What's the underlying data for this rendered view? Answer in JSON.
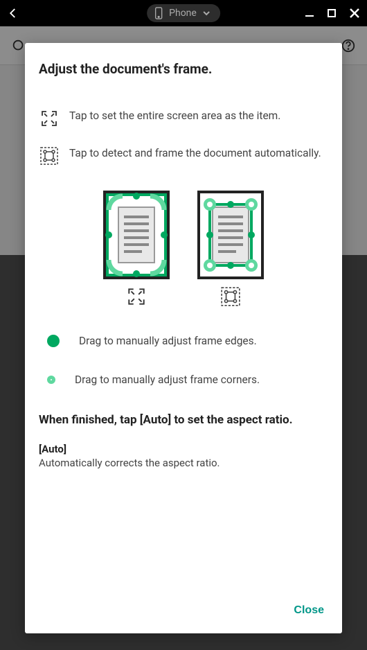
{
  "titlebar": {
    "device_label": "Phone"
  },
  "modal": {
    "title": "Adjust the document's frame.",
    "instructions": {
      "fullscreen": "Tap to set the entire screen area as the item.",
      "autodetect": "Tap to detect and frame the document automatically."
    },
    "legend": {
      "edges": "Drag to manually adjust frame edges.",
      "corners": "Drag to manually adjust frame corners."
    },
    "finish": {
      "heading": "When finished, tap [Auto] to set the aspect ratio.",
      "auto_label": "[Auto]",
      "auto_desc": "Automatically corrects the aspect ratio."
    },
    "close_label": "Close"
  },
  "colors": {
    "accent": "#009688",
    "frame_green": "#00a860",
    "light_green": "#5fd89f"
  }
}
